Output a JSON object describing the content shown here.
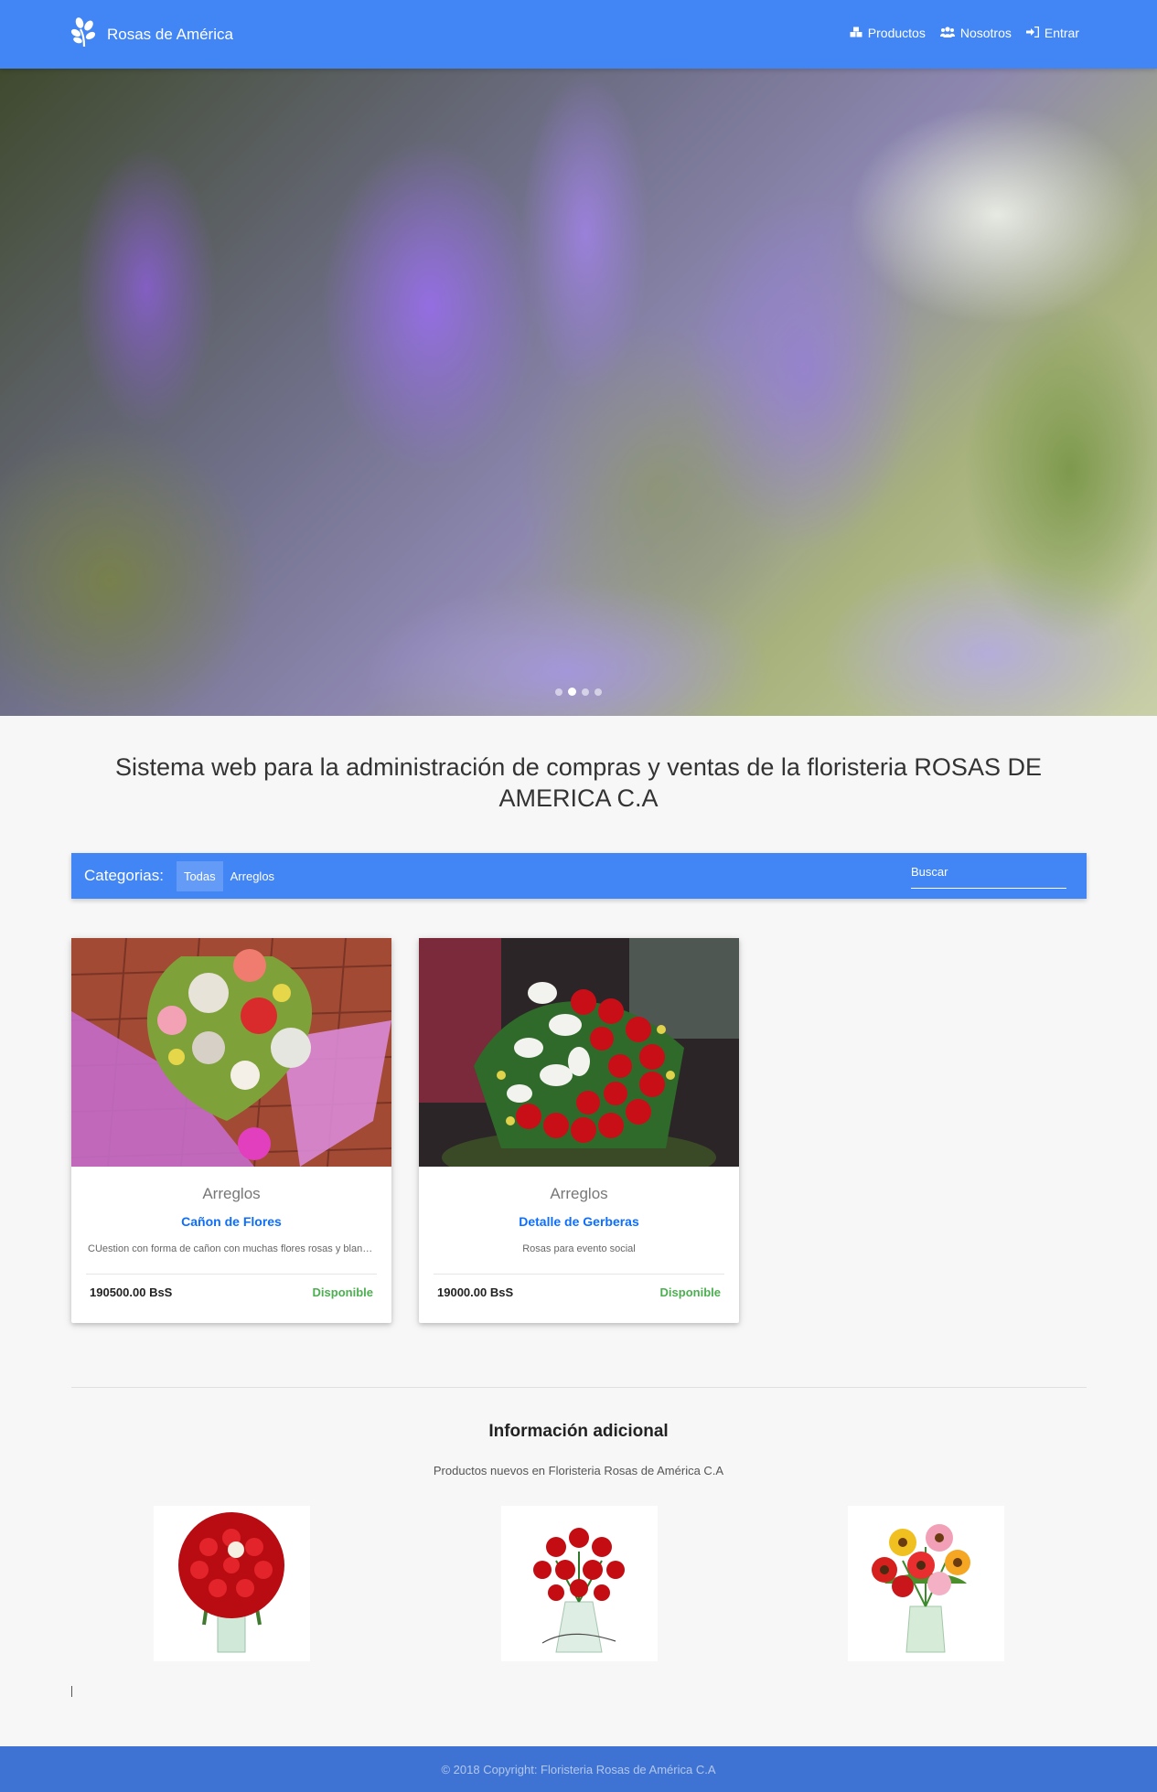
{
  "navbar": {
    "brand": "Rosas de América",
    "links": [
      {
        "label": "Productos",
        "icon": "cubes-icon"
      },
      {
        "label": "Nosotros",
        "icon": "users-icon"
      },
      {
        "label": "Entrar",
        "icon": "sign-in-icon"
      }
    ]
  },
  "hero": {
    "slides": 4,
    "active_slide": 2
  },
  "main": {
    "heading": "Sistema web para la administración de compras y ventas de la floristeria ROSAS DE AMERICA C.A"
  },
  "categories": {
    "label": "Categorias:",
    "items": [
      "Todas",
      "Arreglos"
    ],
    "active": "Todas",
    "search_placeholder": "Buscar"
  },
  "products": [
    {
      "category": "Arreglos",
      "name": "Cañon de Flores",
      "description": "CUestion con forma de cañon con muchas flores rosas y blancas",
      "price": "190500.00 BsS",
      "status": "Disponible"
    },
    {
      "category": "Arreglos",
      "name": "Detalle de Gerberas",
      "description": "Rosas para evento social",
      "price": "19000.00 BsS",
      "status": "Disponible"
    }
  ],
  "info": {
    "title": "Información adicional",
    "subtitle": "Productos nuevos en Floristeria Rosas de América C.A"
  },
  "footer": {
    "text": "© 2018 Copyright: Floristeria Rosas de América C.A"
  },
  "colors": {
    "primary": "#4285f4",
    "footer": "#3f73d3",
    "link": "#0d6efd",
    "available": "#4caf50"
  }
}
